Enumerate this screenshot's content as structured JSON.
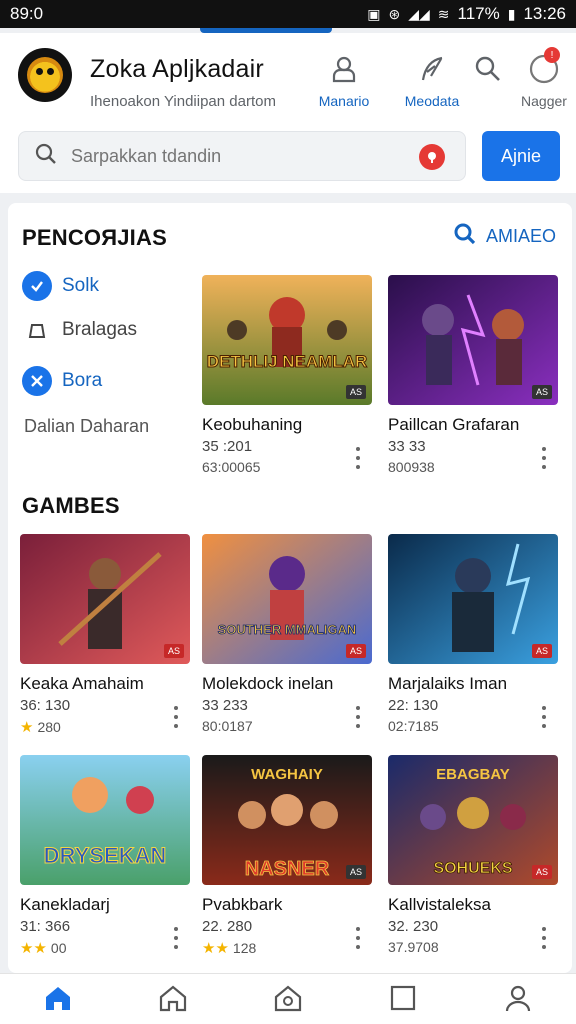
{
  "status": {
    "left": "89:0",
    "battery": "117%",
    "time": "13:26"
  },
  "header": {
    "title": "Zoka Apljkadair",
    "subtitle": "Ihenoakon Yindiipan dartom",
    "actions": [
      {
        "label": "Manario",
        "icon": "profile-icon"
      },
      {
        "label": "Meodata",
        "icon": "feather-icon"
      },
      {
        "label": "",
        "icon": "search-icon"
      },
      {
        "label": "Nagger",
        "icon": "notification-icon"
      }
    ],
    "search": {
      "placeholder": "Sarpakkan tdandin"
    },
    "search_button": "Ajnie"
  },
  "main": {
    "section1": {
      "title": "PENCOЯJIAS",
      "link": "AMIAEO"
    },
    "side_items": [
      {
        "label": "Solk",
        "icon": "check-icon"
      },
      {
        "label": "Bralagas",
        "icon": "box-icon"
      },
      {
        "label": "Bora",
        "icon": "tools-icon"
      },
      {
        "label": "Dalian Daharan"
      }
    ],
    "featured": [
      {
        "name": "Keobuhaning",
        "meta1": "35 :201",
        "meta2": "63:00065",
        "art": "DETHLIJ NEAMLAR",
        "badge": "AS"
      },
      {
        "name": "Paillcan Grafaran",
        "meta1": "33 33",
        "meta2": "800938",
        "art": "",
        "badge": "AS"
      }
    ],
    "section2": {
      "title": "GAMBES"
    },
    "games": [
      {
        "name": "Keaka Amahaim",
        "meta1": "36: 130",
        "meta2": "280",
        "stars": 1,
        "art": "",
        "badge": "AS"
      },
      {
        "name": "Molekdock inelan",
        "meta1": "33 233",
        "meta2": "80:0187",
        "stars": 0,
        "art": "SOUTHER MMALIGAN",
        "badge": "AS"
      },
      {
        "name": "Marjalaiks Iman",
        "meta1": "22: 130",
        "meta2": "02:7185",
        "stars": 0,
        "art": "",
        "badge": "AS"
      },
      {
        "name": "Kanekladarj",
        "meta1": "31: 366",
        "meta2": "00",
        "stars": 2,
        "art": "DRYSEKAN",
        "badge": ""
      },
      {
        "name": "Pvabkbark",
        "meta1": "22. 280",
        "meta2": "128",
        "stars": 2,
        "art": "NASNER",
        "art2": "WAGHAIY",
        "badge": "AS"
      },
      {
        "name": "Kallvistaleksa",
        "meta1": "32. 230",
        "meta2": "37.9708",
        "stars": 0,
        "art": "SOHUEKS",
        "art2": "EBAGBAY",
        "badge": "AS"
      }
    ]
  },
  "bottom_nav": [
    {
      "icon": "home-icon",
      "active": true
    },
    {
      "icon": "house-outline-icon",
      "active": false
    },
    {
      "icon": "lock-home-icon",
      "active": false
    },
    {
      "icon": "square-icon",
      "active": false
    },
    {
      "icon": "user-icon",
      "active": false
    }
  ],
  "colors": {
    "accent": "#1a73e8",
    "brand_text": "#1565c0",
    "alert": "#e53935"
  }
}
